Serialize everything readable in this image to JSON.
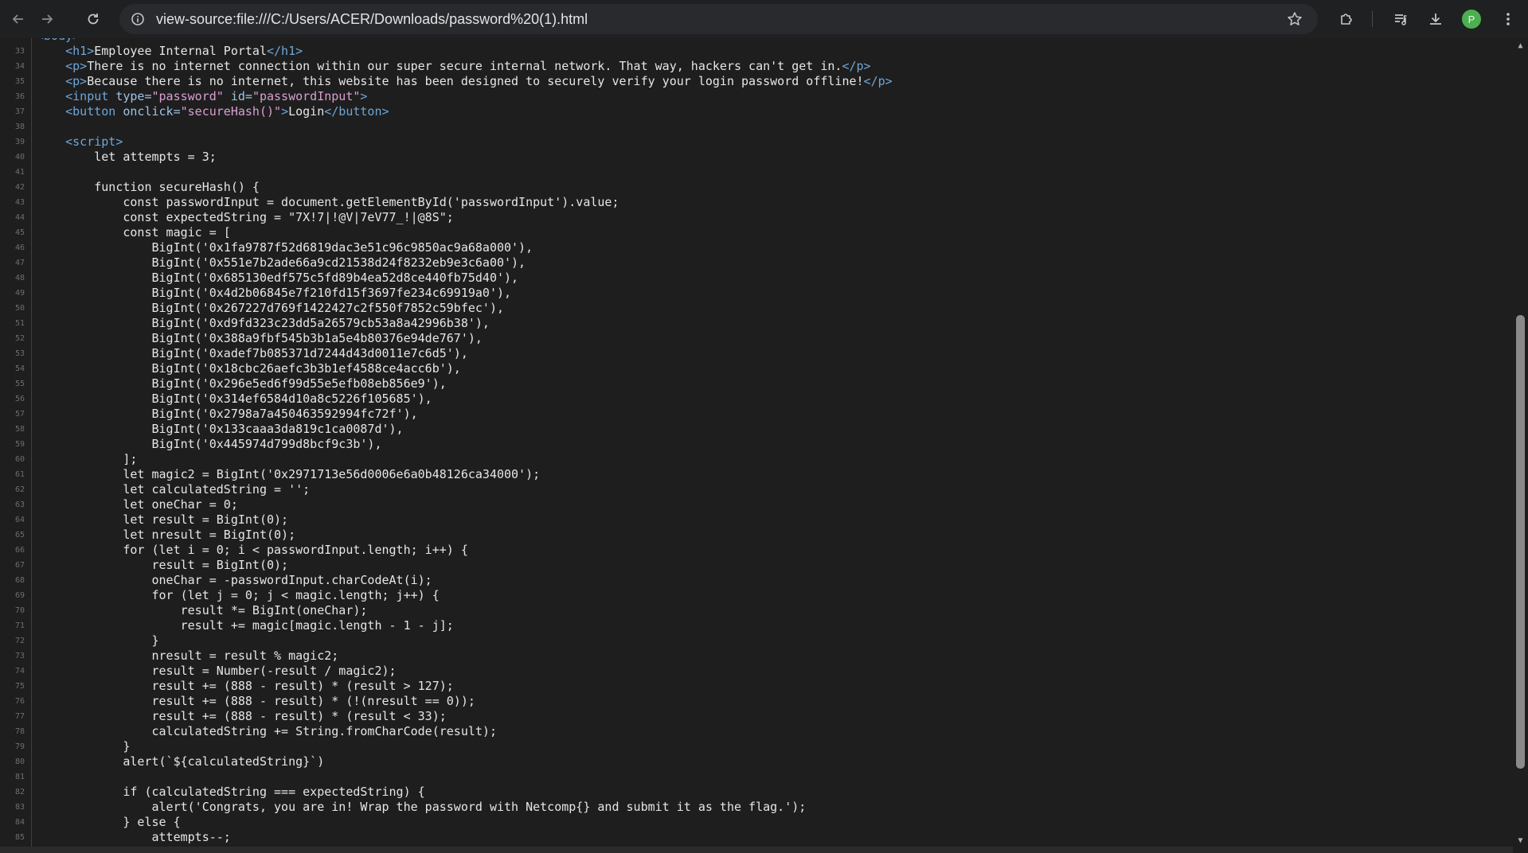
{
  "browser": {
    "url": "view-source:file:///C:/Users/ACER/Downloads/password%20(1).html",
    "profile_initial": "P",
    "icons": {
      "back": "arrow-left-icon",
      "forward": "arrow-right-icon",
      "reload": "reload-icon",
      "site_info": "info-icon",
      "bookmark": "star-icon",
      "extensions": "puzzle-icon",
      "media": "media-queue-icon",
      "downloads": "download-icon",
      "menu": "kebab-menu-icon"
    }
  },
  "source": {
    "first_line_number": 32,
    "lines": [
      [
        {
          "t": "<body>",
          "c": "tag"
        }
      ],
      [
        {
          "t": "    "
        },
        {
          "t": "<h1>",
          "c": "tag"
        },
        {
          "t": "Employee Internal Portal"
        },
        {
          "t": "</h1>",
          "c": "tag"
        }
      ],
      [
        {
          "t": "    "
        },
        {
          "t": "<p>",
          "c": "tag"
        },
        {
          "t": "There is no internet connection within our super secure internal network. That way, hackers can't get in."
        },
        {
          "t": "</p>",
          "c": "tag"
        }
      ],
      [
        {
          "t": "    "
        },
        {
          "t": "<p>",
          "c": "tag"
        },
        {
          "t": "Because there is no internet, this website has been designed to securely verify your login password offline!"
        },
        {
          "t": "</p>",
          "c": "tag"
        }
      ],
      [
        {
          "t": "    "
        },
        {
          "t": "<input",
          "c": "tag"
        },
        {
          "t": " type=",
          "c": "attr"
        },
        {
          "t": "\"password\"",
          "c": "val"
        },
        {
          "t": " id=",
          "c": "attr"
        },
        {
          "t": "\"passwordInput\"",
          "c": "val"
        },
        {
          "t": ">",
          "c": "tag"
        }
      ],
      [
        {
          "t": "    "
        },
        {
          "t": "<button",
          "c": "tag"
        },
        {
          "t": " onclick=",
          "c": "attr"
        },
        {
          "t": "\"secureHash()\"",
          "c": "val"
        },
        {
          "t": ">",
          "c": "tag"
        },
        {
          "t": "Login"
        },
        {
          "t": "</button>",
          "c": "tag"
        }
      ],
      [
        {
          "t": ""
        }
      ],
      [
        {
          "t": "    "
        },
        {
          "t": "<script>",
          "c": "tag"
        }
      ],
      [
        {
          "t": "        let attempts = 3;"
        }
      ],
      [
        {
          "t": ""
        }
      ],
      [
        {
          "t": "        function secureHash() {"
        }
      ],
      [
        {
          "t": "            const passwordInput = document.getElementById('passwordInput').value;"
        }
      ],
      [
        {
          "t": "            const expectedString = \"7X!7|!@V|7eV77_!|@8S\";"
        }
      ],
      [
        {
          "t": "            const magic = ["
        }
      ],
      [
        {
          "t": "                BigInt('0x1fa9787f52d6819dac3e51c96c9850ac9a68a000'),"
        }
      ],
      [
        {
          "t": "                BigInt('0x551e7b2ade66a9cd21538d24f8232eb9e3c6a00'),"
        }
      ],
      [
        {
          "t": "                BigInt('0x685130edf575c5fd89b4ea52d8ce440fb75d40'),"
        }
      ],
      [
        {
          "t": "                BigInt('0x4d2b06845e7f210fd15f3697fe234c69919a0'),"
        }
      ],
      [
        {
          "t": "                BigInt('0x267227d769f1422427c2f550f7852c59bfec'),"
        }
      ],
      [
        {
          "t": "                BigInt('0xd9fd323c23dd5a26579cb53a8a42996b38'),"
        }
      ],
      [
        {
          "t": "                BigInt('0x388a9fbf545b3b1a5e4b80376e94de767'),"
        }
      ],
      [
        {
          "t": "                BigInt('0xadef7b085371d7244d43d0011e7c6d5'),"
        }
      ],
      [
        {
          "t": "                BigInt('0x18cbc26aefc3b3b1ef4588ce4acc6b'),"
        }
      ],
      [
        {
          "t": "                BigInt('0x296e5ed6f99d55e5efb08eb856e9'),"
        }
      ],
      [
        {
          "t": "                BigInt('0x314ef6584d10a8c5226f105685'),"
        }
      ],
      [
        {
          "t": "                BigInt('0x2798a7a450463592994fc72f'),"
        }
      ],
      [
        {
          "t": "                BigInt('0x133caaa3da819c1ca0087d'),"
        }
      ],
      [
        {
          "t": "                BigInt('0x445974d799d8bcf9c3b'),"
        }
      ],
      [
        {
          "t": "            ];"
        }
      ],
      [
        {
          "t": "            let magic2 = BigInt('0x2971713e56d0006e6a0b48126ca34000');"
        }
      ],
      [
        {
          "t": "            let calculatedString = '';"
        }
      ],
      [
        {
          "t": "            let oneChar = 0;"
        }
      ],
      [
        {
          "t": "            let result = BigInt(0);"
        }
      ],
      [
        {
          "t": "            let nresult = BigInt(0);"
        }
      ],
      [
        {
          "t": "            for (let i = 0; i < passwordInput.length; i++) {"
        }
      ],
      [
        {
          "t": "                result = BigInt(0);"
        }
      ],
      [
        {
          "t": "                oneChar = -passwordInput.charCodeAt(i);"
        }
      ],
      [
        {
          "t": "                for (let j = 0; j < magic.length; j++) {"
        }
      ],
      [
        {
          "t": "                    result *= BigInt(oneChar);"
        }
      ],
      [
        {
          "t": "                    result += magic[magic.length - 1 - j];"
        }
      ],
      [
        {
          "t": "                }"
        }
      ],
      [
        {
          "t": "                nresult = result % magic2;"
        }
      ],
      [
        {
          "t": "                result = Number(-result / magic2);"
        }
      ],
      [
        {
          "t": "                result += (888 - result) * (result > 127);"
        }
      ],
      [
        {
          "t": "                result += (888 - result) * (!(nresult == 0));"
        }
      ],
      [
        {
          "t": "                result += (888 - result) * (result < 33);"
        }
      ],
      [
        {
          "t": "                calculatedString += String.fromCharCode(result);"
        }
      ],
      [
        {
          "t": "            }"
        }
      ],
      [
        {
          "t": "            alert(`${calculatedString}`)"
        }
      ],
      [
        {
          "t": ""
        }
      ],
      [
        {
          "t": "            if (calculatedString === expectedString) {"
        }
      ],
      [
        {
          "t": "                alert('Congrats, you are in! Wrap the password with Netcomp{} and submit it as the flag.');"
        }
      ],
      [
        {
          "t": "            } else {"
        }
      ],
      [
        {
          "t": "                attempts--;"
        }
      ]
    ]
  },
  "colors": {
    "tag": "#6ea6d7",
    "attr": "#9cc3e6",
    "val": "#d7a0d0",
    "text": "#e6e6e6",
    "line_number": "#6e6e6e",
    "background": "#1e1e1e"
  }
}
